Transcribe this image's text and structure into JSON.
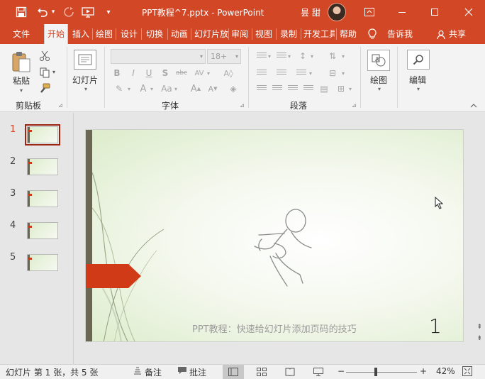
{
  "titlebar": {
    "title": "PPT教程^7.pptx  -  PowerPoint",
    "user": "昙 甜",
    "icons": [
      "save-icon",
      "undo-icon",
      "redo-icon",
      "present-icon",
      "customize-icon",
      "ribbon-display-icon",
      "minimize-icon",
      "maximize-icon",
      "close-icon"
    ]
  },
  "tabs": {
    "items": [
      "文件",
      "开始",
      "插入",
      "绘图",
      "设计",
      "切换",
      "动画",
      "幻灯片放",
      "审阅",
      "视图",
      "录制",
      "开发工具",
      "帮助"
    ],
    "active": "开始",
    "tell_me": "告诉我",
    "share": "共享"
  },
  "ribbon": {
    "clipboard": {
      "paste": "粘贴",
      "label": "剪贴板"
    },
    "slides": {
      "new_slide": "幻灯片"
    },
    "font": {
      "label": "字体",
      "size_placeholder": "18+"
    },
    "paragraph": {
      "label": "段落"
    },
    "drawing": {
      "label": "绘图"
    },
    "editing": {
      "label": "编辑"
    }
  },
  "thumbnails": {
    "numbers": [
      "1",
      "2",
      "3",
      "4",
      "5"
    ],
    "active_index": 1
  },
  "slide": {
    "footer_text": "PPT教程：快速给幻灯片添加页码的技巧",
    "page_number": "1"
  },
  "statusbar": {
    "slide_info": "幻灯片 第 1 张，共 5 张",
    "notes": "备注",
    "comments": "批注",
    "zoom": "42%",
    "zoom_fraction": 0.42
  },
  "colors": {
    "accent": "#d24726",
    "flag": "#d03a16",
    "bar": "#6b6653"
  }
}
